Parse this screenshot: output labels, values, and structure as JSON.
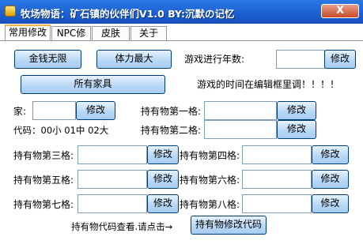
{
  "window": {
    "title": "牧场物语：矿石镇的伙伴们V1.0    BY:沉默の记忆",
    "close_label": "X"
  },
  "tabs": [
    {
      "label": "常用修改",
      "active": true
    },
    {
      "label": "NPC修改",
      "active": false
    },
    {
      "label": "皮肤",
      "active": false
    },
    {
      "label": "关于",
      "active": false
    }
  ],
  "main": {
    "money_button": "金钱无限",
    "stamina_button": "体力最大",
    "years_label": "游戏进行年数:",
    "years_value": "",
    "years_modify": "修改",
    "furniture_button": "所有家具",
    "time_hint": "游戏的时间在编辑框里调！！！！",
    "home_label": "家:",
    "home_value": "",
    "home_modify": "修改",
    "code_hint": "代码：00小    01中    02大",
    "slots": [
      {
        "label": "持有物第一格:",
        "value": "",
        "modify": "修改"
      },
      {
        "label": "持有物第二格:",
        "value": "",
        "modify": "修改"
      },
      {
        "label": "持有物第三格:",
        "value": "",
        "modify": "修改"
      },
      {
        "label": "持有物第四格:",
        "value": "",
        "modify": "修改"
      },
      {
        "label": "持有物第五格:",
        "value": "",
        "modify": "修改"
      },
      {
        "label": "持有物第六格:",
        "value": "",
        "modify": "修改"
      },
      {
        "label": "持有物第七格:",
        "value": "",
        "modify": "修改"
      },
      {
        "label": "持有物第八格:",
        "value": "",
        "modify": "修改"
      }
    ],
    "code_lookup_hint": "持有物代码查看.请点击→",
    "code_lookup_button": "持有物修改代码"
  },
  "colors": {
    "titlebar": "#1d5fd0",
    "button_face": "#bad8f6",
    "tab_active_accent": "#f5b13d"
  }
}
